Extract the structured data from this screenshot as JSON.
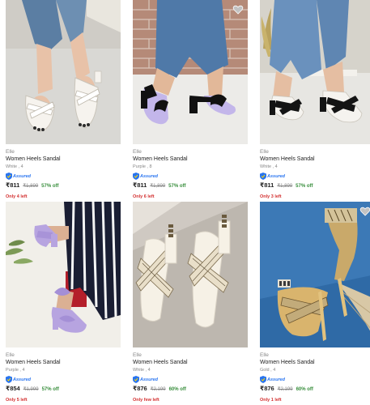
{
  "products": [
    {
      "brand": "Elle",
      "title": "Women Heels Sandal",
      "variant": "White , 4",
      "assured": "Assured",
      "price": "₹811",
      "mrp": "₹1,899",
      "discount": "57% off",
      "stock": "Only 4 left",
      "image_desc": "white-cross-strap-heels"
    },
    {
      "brand": "Elle",
      "title": "Women Heels Sandal",
      "variant": "Purple , 8",
      "assured": "Assured",
      "price": "₹811",
      "mrp": "₹1,899",
      "discount": "57% off",
      "stock": "Only 6 left",
      "image_desc": "black-purple-block-heels"
    },
    {
      "brand": "Elle",
      "title": "Women Heels Sandal",
      "variant": "White , 4",
      "assured": "Assured",
      "price": "₹811",
      "mrp": "₹1,899",
      "discount": "57% off",
      "stock": "Only 3 left",
      "image_desc": "black-white-block-heels"
    },
    {
      "brand": "Elle",
      "title": "Women Heels Sandal",
      "variant": "Purple , 4",
      "assured": "Assured",
      "price": "₹854",
      "mrp": "₹1,999",
      "discount": "57% off",
      "stock": "Only 5 left",
      "image_desc": "lilac-bow-heels"
    },
    {
      "brand": "Elle",
      "title": "Women Heels Sandal",
      "variant": "White , 4",
      "assured": "Assured",
      "price": "₹876",
      "mrp": "₹2,199",
      "discount": "60% off",
      "stock": "Only few left",
      "image_desc": "white-braided-cross-heels"
    },
    {
      "brand": "Elle",
      "title": "Women Heels Sandal",
      "variant": "Gold , 4",
      "assured": "Assured",
      "price": "₹876",
      "mrp": "₹2,199",
      "discount": "60% off",
      "stock": "Only 1 left",
      "image_desc": "gold-strappy-heels"
    }
  ],
  "colors": {
    "assured_blue": "#2874f0",
    "discount_green": "#388e3c",
    "stock_red": "#d32f2f",
    "muted_text": "#878787"
  }
}
